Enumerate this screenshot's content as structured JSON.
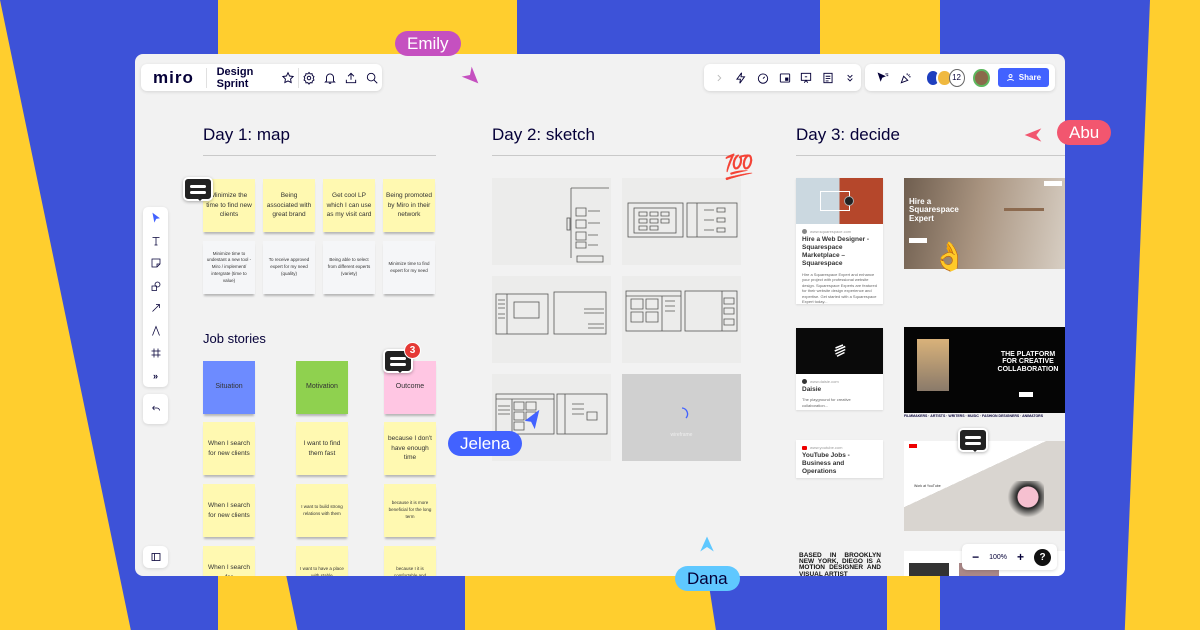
{
  "app": {
    "logo": "miro",
    "board_title": "Design Sprint"
  },
  "top_left_icons": [
    "star-icon",
    "settings-icon",
    "bell-icon",
    "upload-icon",
    "search-icon"
  ],
  "top_right_icons": [
    "chevron-right-icon",
    "lightning-icon",
    "timer-icon",
    "card-icon",
    "presentation-icon",
    "notes-icon",
    "chevrons-down-icon",
    "cursor-filter-icon",
    "celebrate-icon"
  ],
  "collaborators": {
    "extra_count": "12",
    "share_label": "Share"
  },
  "colors": {
    "brand_blue": "#3d52d8",
    "brand_yellow": "#ffce2e",
    "share": "#4262ff",
    "emily": "#c550c0",
    "abu": "#f2566f",
    "jelena": "#4262ff",
    "dana": "#5fc8ff"
  },
  "columns": [
    {
      "title": "Day 1: map"
    },
    {
      "title": "Day 2: sketch"
    },
    {
      "title": "Day 3: decide"
    }
  ],
  "day1": {
    "yellow_notes": [
      "Minimize the time to find new clients",
      "Being associated with great brand",
      "Get cool LP which I can use as my visit card",
      "Being promoted by Miro in their network"
    ],
    "white_notes": [
      "Minimize time to undestant a new tool - Miro / implement/ intergrate (time to value)",
      "To receive approved expert for my need (quality)",
      "Being able to select from different experts (variety)",
      "Minimize time to find expert for my need"
    ],
    "job_stories_title": "Job stories",
    "headers": [
      "Situation",
      "Motivation",
      "Outcome"
    ],
    "rows": [
      [
        "When I search for new clients",
        "I want to find them fast",
        "because I don't have enough time"
      ],
      [
        "When I search for new clients",
        "I want to build strong relations with them",
        "because it is more beneficial for the long term"
      ],
      [
        "When I search for",
        "I want to have a place with stable",
        "because I it is comfortable and"
      ]
    ],
    "comment_badge": "3"
  },
  "day2": {
    "emoji": "💯",
    "loading_label": "wireframe"
  },
  "day3": {
    "cards": [
      {
        "url": "www.squarespace.com",
        "title": "Hire a Web Designer - Squarespace Marketplace – Squarespace",
        "desc": "Hire a Squarespace Expert and enhance your project with professional website design. Squarespace Experts are featured for their website design experience and expertise. Get started with a Squarespace Expert today..."
      },
      {
        "url": "www.daisie.com",
        "title": "Daisie",
        "desc": "The playground for creative collaboration..."
      },
      {
        "url": "www.youtube.com",
        "title": "YouTube Jobs - Business and Operations",
        "desc": ""
      }
    ],
    "squarespace_hero": "Hire a Squarespace Expert",
    "daisie_hero": "THE PLATFORM FOR CREATIVE COLLABORATION",
    "daisie_ticker": "FILMMAKERS · ARTISTS · WRITERS · MUSIC · FASHION DESIGNERS · ANIMATORS",
    "youtube_caption": "Work at YouTube",
    "brooklyn_text": "BASED IN BROOKLYN NEW YORK, DIEGO IS A MOTION DESIGNER AND VISUAL ARTIST",
    "ok_emoji": "👌"
  },
  "zoom": {
    "level": "100%",
    "minus": "−",
    "plus": "+",
    "help": "?"
  },
  "cursors": [
    {
      "name": "Emily"
    },
    {
      "name": "Abu"
    },
    {
      "name": "Jelena"
    },
    {
      "name": "Dana"
    }
  ]
}
